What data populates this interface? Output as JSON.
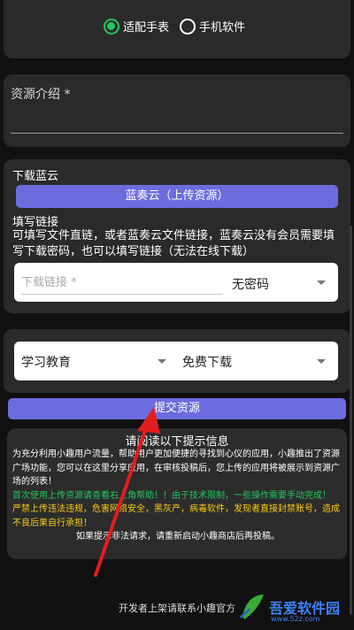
{
  "radio_group": {
    "option_watch": "适配手表",
    "option_phone": "手机软件",
    "selected": "适配手表"
  },
  "description": {
    "label": "资源介绍 *"
  },
  "download": {
    "title": "下载蓝云",
    "lanzou_button": "蓝奏云（上传资源）",
    "fill_label": "填写链接",
    "fill_desc": "可填写文件直链，或者蓝奏云文件链接，蓝奏云没有会员需要填写下载密码，也可以填写链接（无法在线下载）",
    "link_placeholder": "下载链接 *",
    "password_option": "无密码"
  },
  "category": {
    "category_value": "学习教育",
    "download_type_value": "免费下载"
  },
  "submit_label": "提交资源",
  "notice": {
    "title": "请阅读以下提示信息",
    "para1": "为充分利用小趣用户流量，帮助用户更加便捷的寻找到心仪的应用，小趣推出了资源广场功能，您可以在这里分享应用，在审核投稿后，您上传的应用将被展示到资源广场的列表！",
    "para2": "首次使用上传资源请查看右上角帮助！！由于技术限制，一些操作需要手动完成！",
    "para3": "严禁上传违法违规，危害网络安全，黑灰产，病毒软件，发现者直接封禁账号，造成不良后果自行承担！",
    "para4": "如果提示非法请求，请重新启动小趣商店后再投稿。"
  },
  "footer": "开发者上架请联系小趣官方",
  "watermark": {
    "text": "吾爱软件园",
    "url": "www.52z.com"
  },
  "colors": {
    "accent": "#6c6cdf",
    "radio_selected": "#22c55e",
    "arrow": "#e11d1d",
    "notice_green": "#22c55e",
    "notice_yellow": "#facc15"
  }
}
